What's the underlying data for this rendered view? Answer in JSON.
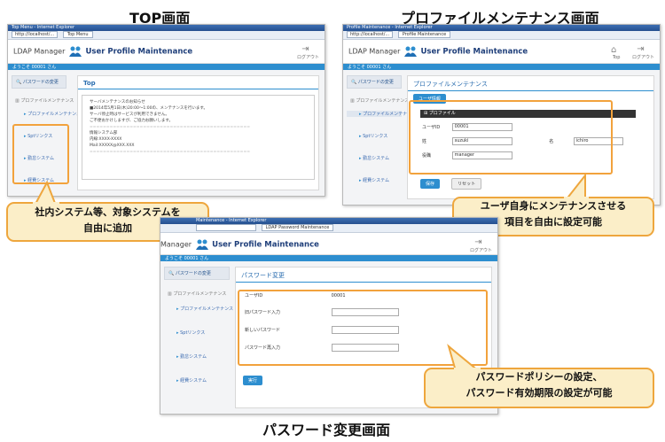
{
  "titles": {
    "top": "TOP画面",
    "profile": "プロファイルメンテナンス画面",
    "password": "パスワード変更画面"
  },
  "app": {
    "brand_left": "LDAP Manager",
    "brand_app": "User Profile Maintenance",
    "user_bar": "ようこそ 00001 さん",
    "logout_label": "ログアウト",
    "top_label": "Top"
  },
  "sidebar": {
    "password_change": "パスワードの変更",
    "profile_group": "プロファイルメンテナンス",
    "profile_item": "プロファイルメンテナンス",
    "systems": [
      "Sptリンクス",
      "勤怠システム",
      "経費システム"
    ]
  },
  "top_window": {
    "title": "Top Menu - Internet Explorer",
    "url": "http://localhost/...",
    "tab": "Top Menu",
    "panel_title": "Top",
    "notice_lines": [
      "サーバメンテナンスのお知らせ",
      "■2014年5月1日(木)20:00〜1:00の、メンテナンスを行います。",
      "サーバ停止時はサービスが利用できません。",
      "ご不便おかけしますが、ご協力お願いします。",
      "情報システム部",
      "内線:XXXX-XXXX",
      "Mail:XXXXX@XXX.XXX"
    ]
  },
  "profile_window": {
    "title": "Profile Maintenance - Internet Explorer",
    "url": "http://localhost/...",
    "tab": "Profile Maintenance",
    "panel_title": "プロファイルメンテナンス",
    "subtab": "ユーザ情報",
    "section": "プロファイル",
    "fields": {
      "userid_label": "ユーザID",
      "userid_value": "00001",
      "last_label": "姓",
      "last_value": "suzuki",
      "first_label": "名",
      "first_value": "ichiro",
      "role_label": "役職",
      "role_value": "manager"
    },
    "save_button": "保存",
    "reset_button": "リセット"
  },
  "password_window": {
    "title": "Maintenance - Internet Explorer",
    "tab": "LDAP Password Maintenance",
    "panel_title": "パスワード変更",
    "fields": {
      "userid_label": "ユーザID",
      "userid_value": "00001",
      "old_label": "旧パスワード入力",
      "new_label": "新しいパスワード",
      "confirm_label": "パスワード再入力"
    },
    "submit_button": "実行"
  },
  "callouts": {
    "add_systems": [
      "社内システム等、対象システムを",
      "自由に追加"
    ],
    "maintain": [
      "ユーザ自身にメンテナンスさせる",
      "項目を自由に設定可能"
    ],
    "policy": [
      "パスワードポリシーの設定、",
      "パスワード有効期限の設定が可能"
    ]
  }
}
